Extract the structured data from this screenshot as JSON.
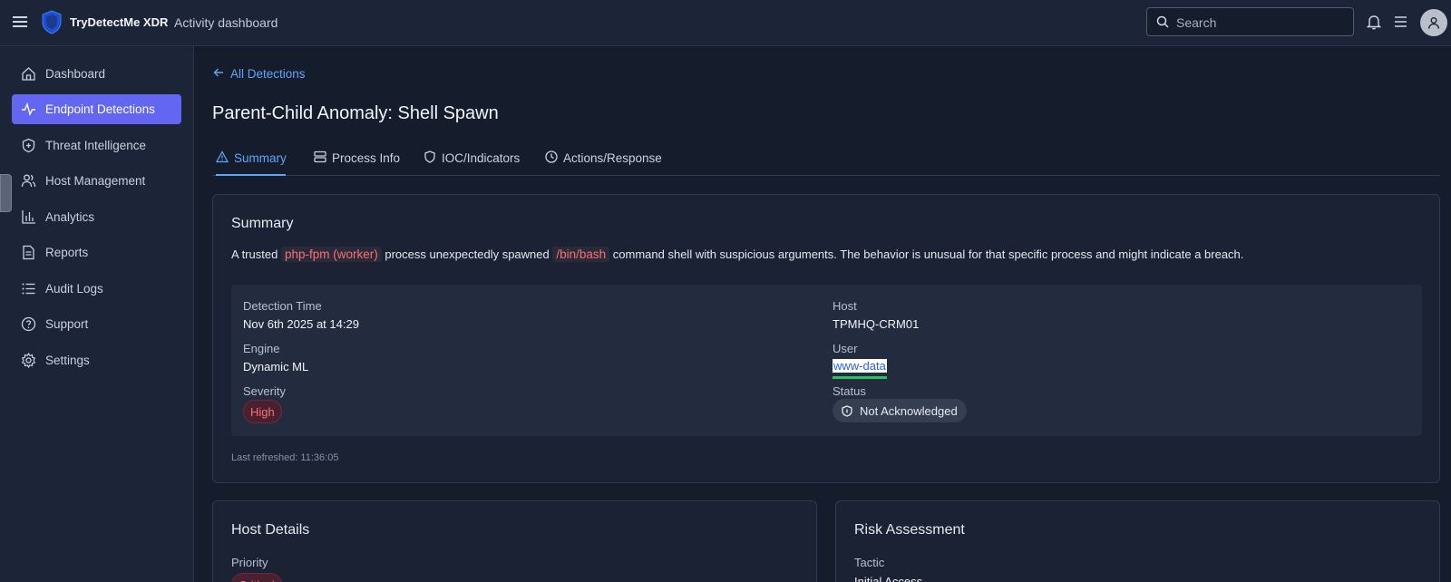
{
  "topbar": {
    "brand": "TryDetectMe XDR",
    "subtitle": "Activity dashboard",
    "search_placeholder": "Search"
  },
  "sidebar": {
    "items": [
      {
        "label": "Dashboard",
        "icon": "home-icon"
      },
      {
        "label": "Endpoint Detections",
        "icon": "activity-icon",
        "active": true
      },
      {
        "label": "Threat Intelligence",
        "icon": "shield-plus-icon"
      },
      {
        "label": "Host Management",
        "icon": "users-icon"
      },
      {
        "label": "Analytics",
        "icon": "bar-chart-icon"
      },
      {
        "label": "Reports",
        "icon": "file-text-icon"
      },
      {
        "label": "Audit Logs",
        "icon": "list-icon"
      },
      {
        "label": "Support",
        "icon": "help-circle-icon"
      },
      {
        "label": "Settings",
        "icon": "gear-icon"
      }
    ]
  },
  "main": {
    "back_label": "All Detections",
    "title": "Parent-Child Anomaly: Shell Spawn",
    "tabs": [
      {
        "label": "Summary",
        "icon": "alert-triangle-icon",
        "active": true
      },
      {
        "label": "Process Info",
        "icon": "server-icon"
      },
      {
        "label": "IOC/Indicators",
        "icon": "shield-icon"
      },
      {
        "label": "Actions/Response",
        "icon": "clock-icon"
      }
    ],
    "summary": {
      "heading": "Summary",
      "text_1": "A trusted",
      "process": "php-fpm (worker)",
      "text_2": "process unexpectedly spawned",
      "shell": "/bin/bash",
      "text_3": "command shell with suspicious arguments. The behavior is unusual for that specific process and might indicate a breach.",
      "detection_time_label": "Detection Time",
      "detection_time": "Nov 6th 2025 at 14:29",
      "engine_label": "Engine",
      "engine": "Dynamic ML",
      "severity_label": "Severity",
      "severity": "High",
      "host_label": "Host",
      "host": "TPMHQ-CRM01",
      "user_label": "User",
      "user": "www-data",
      "status_label": "Status",
      "status": "Not Acknowledged",
      "last_refreshed": "Last refreshed: 11:36:05"
    },
    "host_details": {
      "heading": "Host Details",
      "priority_label": "Priority",
      "priority": "Critical"
    },
    "risk_assessment": {
      "heading": "Risk Assessment",
      "tactic_label": "Tactic",
      "tactic": "Initial Access"
    }
  },
  "colors": {
    "accent": "#6366f1",
    "link": "#60a5fa",
    "danger": "#f87171",
    "background": "#151c2c",
    "panel": "#1c2438"
  }
}
